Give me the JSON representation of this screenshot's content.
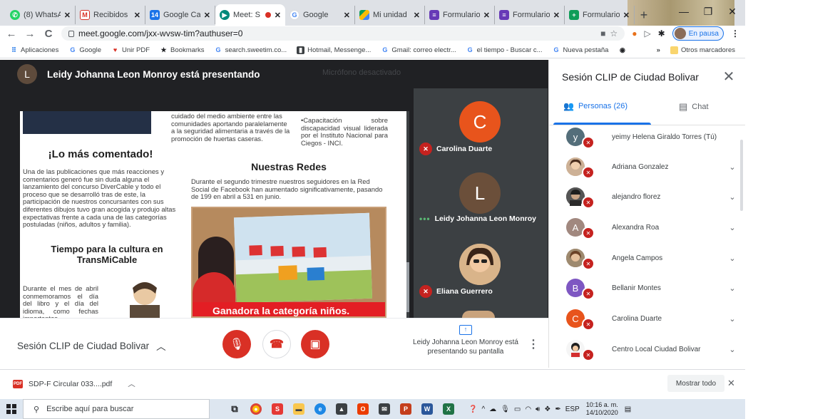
{
  "browser": {
    "tabs": [
      {
        "label": "(8) WhatsA",
        "icon": "whatsapp-icon",
        "color": "#25d366"
      },
      {
        "label": "Recibidos (",
        "icon": "gmail-icon",
        "color": "#d93025"
      },
      {
        "label": "Google Cal",
        "icon": "calendar-icon",
        "color": "#1a73e8"
      },
      {
        "label": "Meet: S",
        "icon": "meet-icon",
        "color": "#00897b",
        "active": true
      },
      {
        "label": "Google",
        "icon": "google-icon",
        "color": "#4285f4"
      },
      {
        "label": "Mi unidad",
        "icon": "drive-icon",
        "color": "#fbbc04"
      },
      {
        "label": "Formulario",
        "icon": "forms-icon",
        "color": "#673ab7"
      },
      {
        "label": "Formulario",
        "icon": "forms-icon",
        "color": "#673ab7"
      },
      {
        "label": "Formulario",
        "icon": "forms-plus-icon",
        "color": "#0f9d58"
      }
    ],
    "url": "meet.google.com/jxx-wvsw-tim?authuser=0",
    "profile_status": "En pausa",
    "bookmarks": [
      {
        "label": "Aplicaciones",
        "icon": "apps-grid-icon"
      },
      {
        "label": "Google",
        "icon": "google-icon"
      },
      {
        "label": "Unir PDF",
        "icon": "pdf-heart-icon"
      },
      {
        "label": "Bookmarks",
        "icon": "star-icon"
      },
      {
        "label": "search.sweetim.co...",
        "icon": "google-icon"
      },
      {
        "label": "Hotmail, Messenge...",
        "icon": "msn-icon"
      },
      {
        "label": "Gmail: correo electr...",
        "icon": "google-icon"
      },
      {
        "label": "el tiempo - Buscar c...",
        "icon": "google-icon"
      },
      {
        "label": "Nueva pestaña",
        "icon": "google-icon"
      }
    ],
    "bookmarks_more": "»",
    "other_bookmarks": "Otros marcadores"
  },
  "meet": {
    "presenter_initial": "L",
    "presenter_banner": "Leidy Johanna Leon Monroy está presentando",
    "mic_faint": "Micrófono desactivado",
    "tiles": [
      {
        "initial": "C",
        "name": "Carolina Duarte",
        "color": "#e8541c",
        "muted": true
      },
      {
        "initial": "L",
        "name": "Leidy Johanna Leon Monroy",
        "color": "#6b4f3a",
        "muted": false
      },
      {
        "initial": "",
        "name": "Eliana Guerrero",
        "color": "#c9a37d",
        "muted": true
      }
    ],
    "meeting_name": "Sesión CLIP de Ciudad Bolivar",
    "presenting_note": "Leidy Johanna Leon Monroy está presentando su pantalla"
  },
  "document": {
    "top_text": "cuidado del medio ambiente entre las comunidades aportando paralelamente a la seguridad alimentaria a través de la promoción de huertas caseras.",
    "bullet": "•Capacitación sobre discapacidad visual liderada por el Instituto Nacional para Ciegos - INCI.",
    "heading_1": "¡Lo más comentado!",
    "para_1": "Una de las publicaciones que más reacciones y comentarios generó fue sin duda alguna el lanzamiento del concurso DiverCable y todo el proceso que se desarrolló tras de este, la participación de nuestros concursantes con sus diferentes dibujos tuvo gran acogida y produjo altas expectativas frente a cada una de las categorías postuladas (niños, adultos y familia).",
    "heading_2": "Nuestras Redes",
    "para_2": "Durante el segundo trimestre nuestros seguidores en la Red Social de Facebook han aumentado significativamente, pasando de 199 en abril a 531 en junio.",
    "heading_3": "Tiempo para la cultura en TransMiCable",
    "para_3": "Durante el mes de abril conmemoramos el día del libro y el día del idioma, como fechas importantes",
    "image_caption": "Ganadora la categoría niños."
  },
  "side_panel": {
    "title": "Sesión CLIP de Ciudad Bolivar",
    "people_tab": "Personas (26)",
    "chat_tab": "Chat",
    "people": [
      {
        "initial": "y",
        "name": "yeimy Helena Giraldo Torres (Tú)",
        "color": "#546e7a",
        "photo": false
      },
      {
        "initial": "",
        "name": "Adriana Gonzalez",
        "color": "#a1887f",
        "photo": true
      },
      {
        "initial": "",
        "name": "alejandro florez",
        "color": "#424242",
        "photo": true
      },
      {
        "initial": "A",
        "name": "Alexandra Roa",
        "color": "#a1887f",
        "photo": false
      },
      {
        "initial": "",
        "name": "Angela Campos",
        "color": "#8d6e63",
        "photo": true
      },
      {
        "initial": "B",
        "name": "Bellanir Montes",
        "color": "#7e57c2",
        "photo": false
      },
      {
        "initial": "C",
        "name": "Carolina Duarte",
        "color": "#e8541c",
        "photo": false
      },
      {
        "initial": "",
        "name": "Centro Local Ciudad Bolivar",
        "color": "#5d4037",
        "photo": true
      }
    ]
  },
  "downloads": {
    "file": "SDP-F Circular 033....pdf",
    "show_all": "Mostrar todo"
  },
  "taskbar": {
    "search_placeholder": "Escribe aquí para buscar",
    "lang": "ESP",
    "time": "10:16 a. m.",
    "date": "14/10/2020"
  },
  "colors": {
    "meet_dark": "#202124",
    "hangup": "#d93025",
    "accent": "#1a73e8"
  }
}
